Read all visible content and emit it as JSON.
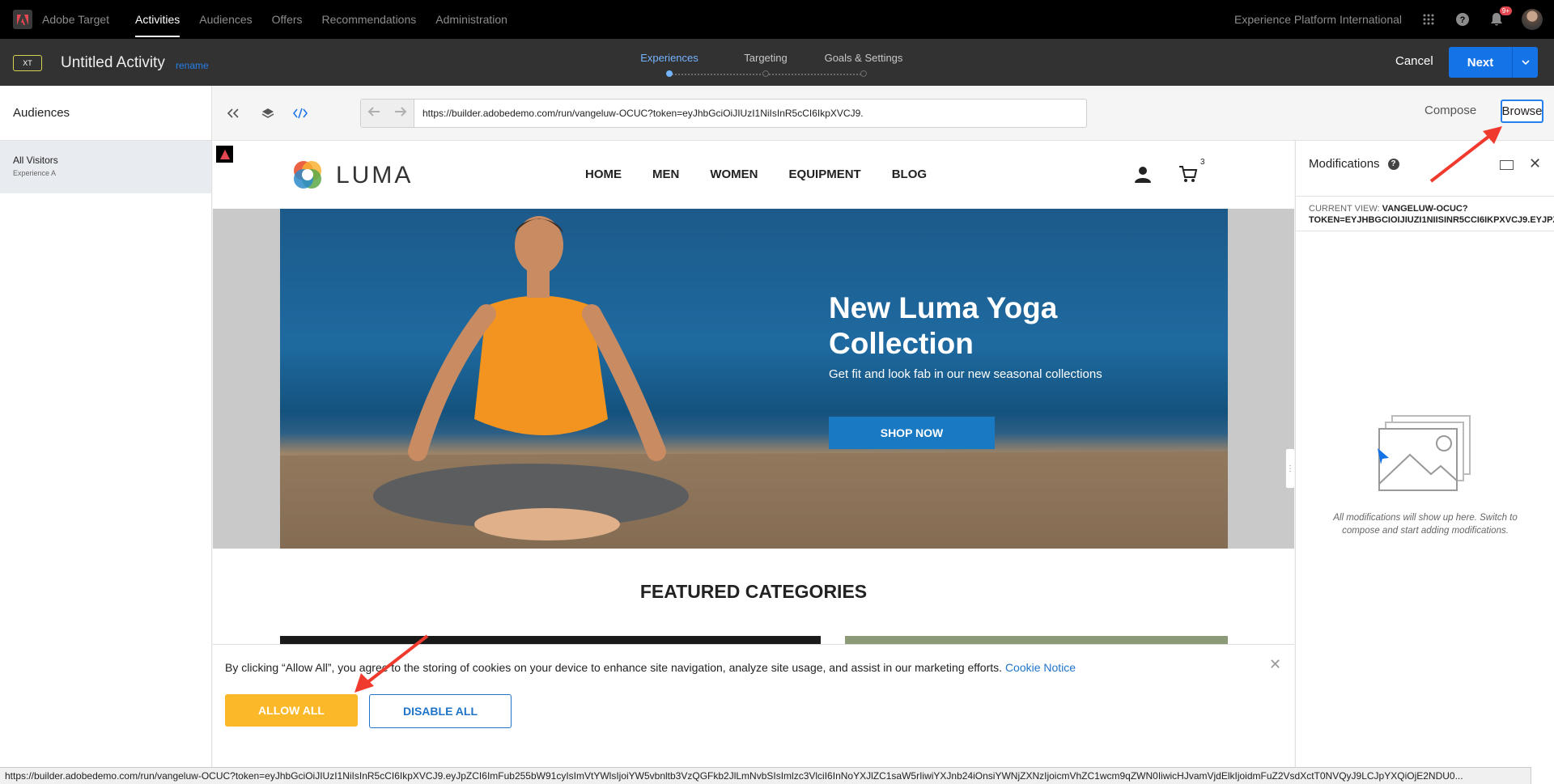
{
  "topnav": {
    "app_name": "Adobe Target",
    "items": [
      {
        "label": "Activities",
        "active": true
      },
      {
        "label": "Audiences",
        "active": false
      },
      {
        "label": "Offers",
        "active": false
      },
      {
        "label": "Recommendations",
        "active": false
      },
      {
        "label": "Administration",
        "active": false
      }
    ],
    "org": "Experience Platform International",
    "notification_badge": "9+"
  },
  "activity": {
    "type_badge": "XT",
    "title": "Untitled Activity",
    "rename_label": "rename",
    "steps": [
      {
        "label": "Experiences",
        "active": true
      },
      {
        "label": "Targeting",
        "active": false
      },
      {
        "label": "Goals & Settings",
        "active": false
      }
    ],
    "cancel_label": "Cancel",
    "next_label": "Next"
  },
  "left_rail": {
    "header": "Audiences",
    "items": [
      {
        "name": "All Visitors",
        "experience": "Experience A"
      }
    ]
  },
  "toolbar": {
    "url": "https://builder.adobedemo.com/run/vangeluw-OCUC?token=eyJhbGciOiJIUzI1NiIsInR5cCI6IkpXVCJ9.eyJp",
    "compose_label": "Compose",
    "browse_label": "Browse"
  },
  "luma": {
    "brand": "LUMA",
    "menu": [
      "HOME",
      "MEN",
      "WOMEN",
      "EQUIPMENT",
      "BLOG"
    ],
    "cart_count": "3",
    "hero_title": "New Luma Yoga Collection",
    "hero_subtitle": "Get fit and look fab in our new seasonal collections",
    "hero_cta": "SHOP NOW",
    "featured_heading": "FEATURED CATEGORIES"
  },
  "cookie": {
    "text": "By clicking “Allow All”, you agree to the storing of cookies on your device to enhance site navigation, analyze site usage, and assist in our marketing efforts.",
    "link": "Cookie Notice",
    "allow_label": "ALLOW ALL",
    "disable_label": "DISABLE ALL"
  },
  "modifications": {
    "title": "Modifications",
    "current_view_label": "CURRENT VIEW:",
    "current_view_line1": "VANGELUW-OCUC?",
    "current_view_line2": "TOKEN=EYJHBGCIOIJIUZI1NIISINR5CCI6IKPXVCJ9.EYJPZ",
    "empty_text": "All modifications will show up here. Switch to compose and start adding modifications."
  },
  "statusbar": {
    "url": "https://builder.adobedemo.com/run/vangeluw-OCUC?token=eyJhbGciOiJIUzI1NiIsInR5cCI6IkpXVCJ9.eyJpZCI6ImFub255bW91cyIsImVtYWlsIjoiYW5vbnltb3VzQGFkb2JlLmNvbSIsImlzc3VlciI6InNoYXJlZC1saW5rIiwiYXJnb24iOnsiYWNjZXNzIjoicmVhZC1wcm9qZWN0IiwicHJvamVjdElkIjoidmFuZ2VsdXctT0NVQyJ9LCJpYXQiOjE2NDU0..."
  },
  "colors": {
    "accent_blue": "#1473e6",
    "allow_yellow": "#fbb929",
    "annotation_red": "#f03a2e"
  }
}
